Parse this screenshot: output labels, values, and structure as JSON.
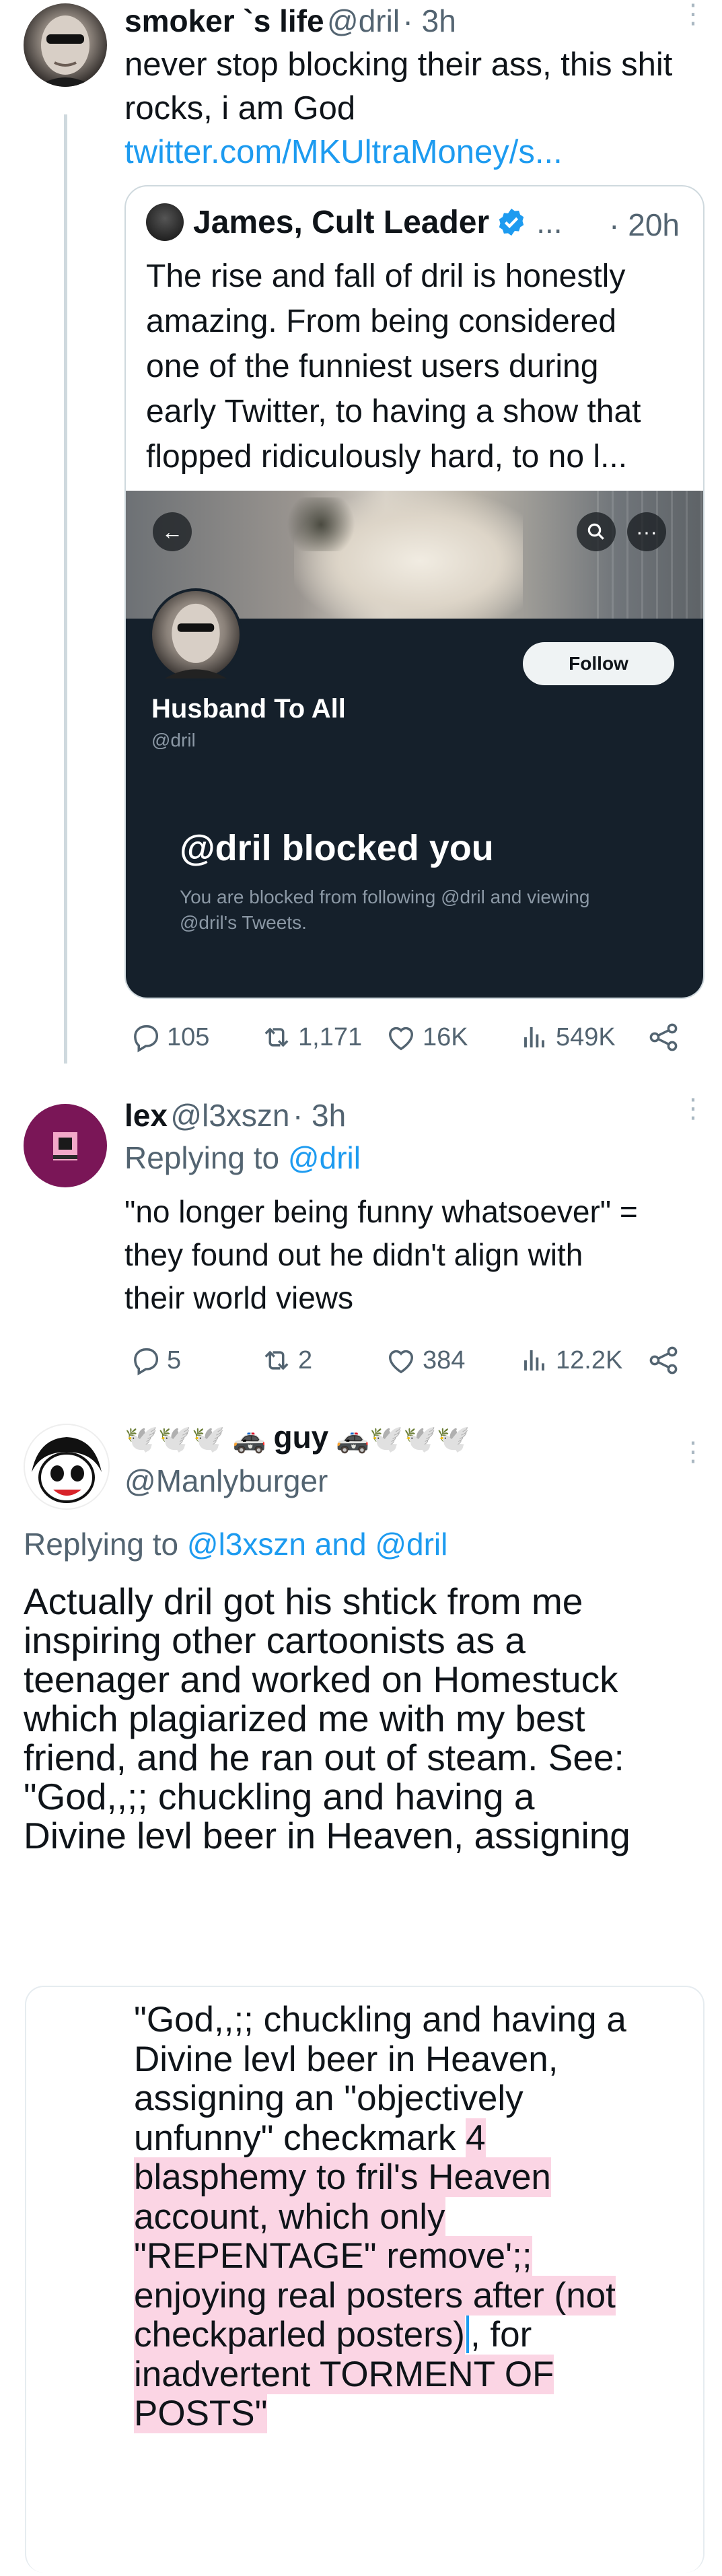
{
  "tweet1": {
    "name": "smoker `s life",
    "handle": "@dril",
    "time": "· 3h",
    "text_lines": [
      "never stop blocking their ass, this shit",
      "rocks, i am God"
    ],
    "link": "twitter.com/MKUltraMoney/s...",
    "quote": {
      "name": "James, Cult Leader",
      "ellipsis": "...",
      "time": "· 20h",
      "text_lines": [
        "The rise and fall of dril is honestly",
        "amazing. From being considered",
        "one of the funniest users during",
        "early Twitter, to having a show that",
        "flopped ridiculously hard, to no l..."
      ],
      "embed": {
        "follow_label": "Follow",
        "profile_name": "Husband To All",
        "profile_handle": "@dril",
        "blocked_title": "@dril blocked you",
        "blocked_desc_lines": [
          "You are blocked from following @dril and viewing",
          "@dril's Tweets."
        ]
      }
    },
    "stats": {
      "replies": "105",
      "retweets": "1,171",
      "likes": "16K",
      "views": "549K"
    }
  },
  "tweet2": {
    "name": "lex",
    "handle": "@l3xszn",
    "time": "· 3h",
    "replying_prefix": "Replying to",
    "replying_to": "@dril",
    "text_lines": [
      "\"no longer being funny whatsoever\" =",
      "they found out he didn't align with",
      "their world views"
    ],
    "stats": {
      "replies": "5",
      "retweets": "2",
      "likes": "384",
      "views": "12.2K"
    }
  },
  "tweet3": {
    "name_prefix": "🕊️🕊️🕊️ 🚓",
    "name_core": "guy",
    "name_suffix": "🚓🕊️🕊️🕊️",
    "handle": "@Manlyburger",
    "replying_prefix": "Replying to",
    "replying_to": "@l3xszn and @dril",
    "text_lines": [
      "Actually dril got his shtick from me",
      "inspiring other cartoonists as a",
      "teenager and worked on Homestuck",
      "which plagiarized me with my best",
      "friend, and he ran out of steam. See:",
      "\"God,,;; chuckling and having a",
      "Divine levl beer in Heaven, assigning"
    ],
    "quote_block": {
      "line1": "\"God,,;; chuckling and having a",
      "line2": "Divine levl beer in Heaven,",
      "line3": "assigning an \"objectively",
      "line4_plain": "unfunny\" checkmark ",
      "line4_hl": "4",
      "line5": "blasphemy to fril's Heaven",
      "line6": "account, which only",
      "line7": "\"REPENTAGE\" remove';;",
      "line8": "enjoying real posters after (not",
      "line9_hl": "checkparled posters)",
      "line9_plain": ", for",
      "line10": "inadvertent TORMENT OF",
      "line11": "POSTS\""
    }
  },
  "colors": {
    "link": "#1d9bf0",
    "secondary": "#536471",
    "verified": "#1d9bf0",
    "highlight": "#fbd5e4",
    "embed_bg": "#15202b"
  },
  "icons": [
    "reply-icon",
    "retweet-icon",
    "like-icon",
    "views-icon",
    "share-icon",
    "verified-badge-icon",
    "back-arrow-icon",
    "search-icon",
    "more-icon"
  ]
}
